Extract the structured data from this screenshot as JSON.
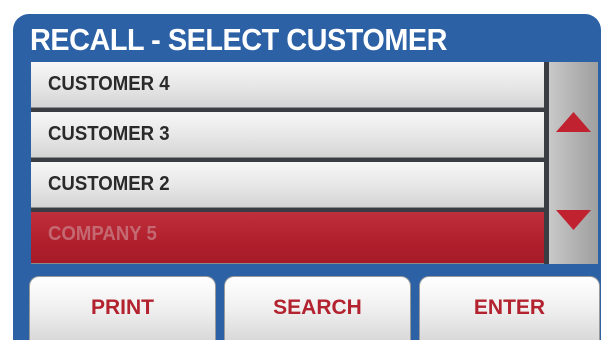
{
  "header": {
    "title": "RECALL - SELECT CUSTOMER"
  },
  "customer_list": {
    "items": [
      {
        "label": "CUSTOMER 4",
        "selected": false
      },
      {
        "label": "CUSTOMER 3",
        "selected": false
      },
      {
        "label": "CUSTOMER 2",
        "selected": false
      },
      {
        "label": "COMPANY 5",
        "selected": true
      }
    ]
  },
  "scrollbar": {
    "up_icon": "triangle-up-icon",
    "down_icon": "triangle-down-icon"
  },
  "footer": {
    "print_label": "PRINT",
    "search_label": "SEARCH",
    "enter_label": "ENTER"
  },
  "colors": {
    "panel": "#2c61a6",
    "selected_row": "#b01f2c",
    "accent_text": "#b3222f",
    "arrow": "#c0232f"
  }
}
